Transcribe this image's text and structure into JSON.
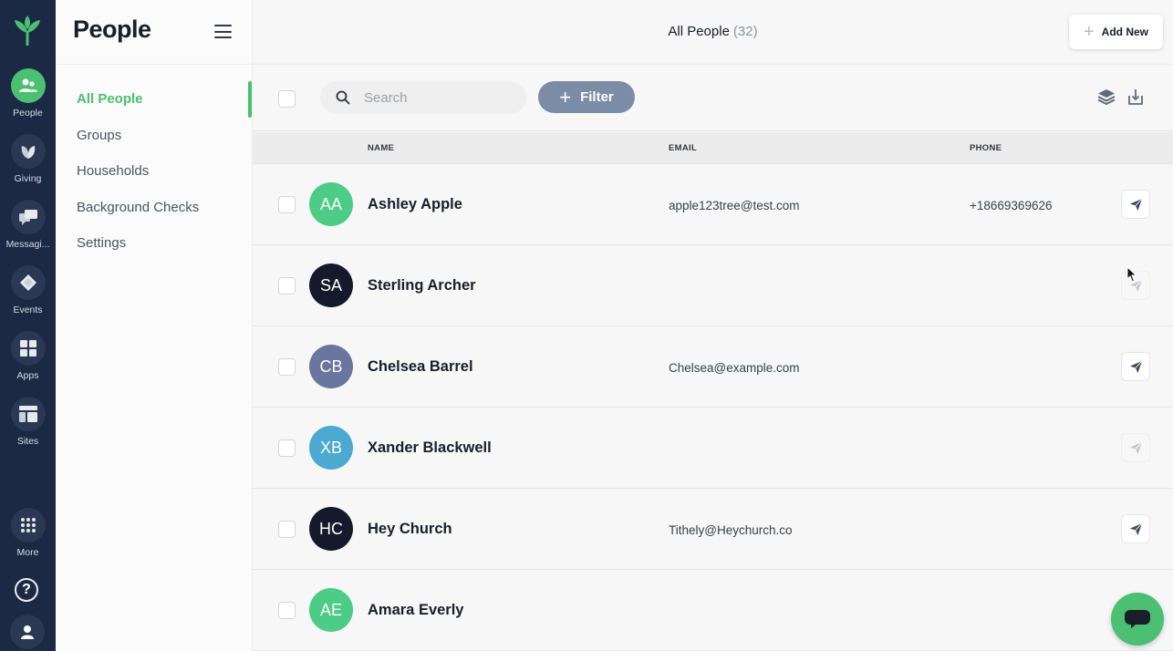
{
  "app": {
    "colors": {
      "rail_bg": "#1b2944",
      "accent": "#4bbf72",
      "filter_bg": "#7b8da6"
    }
  },
  "rail": {
    "items": [
      {
        "label": "People",
        "icon": "people-icon",
        "active": true
      },
      {
        "label": "Giving",
        "icon": "leaf-icon",
        "active": false
      },
      {
        "label": "Messagi...",
        "icon": "message-icon",
        "active": false
      },
      {
        "label": "Events",
        "icon": "ticket-icon",
        "active": false
      },
      {
        "label": "Apps",
        "icon": "apps-grid-icon",
        "active": false
      },
      {
        "label": "Sites",
        "icon": "layout-icon",
        "active": false
      },
      {
        "label": "More",
        "icon": "dots-grid-icon",
        "active": false
      }
    ],
    "help_glyph": "?"
  },
  "subnav": {
    "title": "People",
    "items": [
      "All People",
      "Groups",
      "Households",
      "Background Checks",
      "Settings"
    ],
    "active_index": 0
  },
  "topbar": {
    "title": "All People",
    "count": "(32)",
    "add_new_label": "Add New"
  },
  "toolbar": {
    "search_placeholder": "Search",
    "filter_label": "Filter"
  },
  "table": {
    "columns": [
      "NAME",
      "EMAIL",
      "PHONE"
    ],
    "rows": [
      {
        "initials": "AA",
        "name": "Ashley Apple",
        "email": "apple123tree@test.com",
        "phone": "+18669369626",
        "avatar_color": "#4ccc87",
        "send_enabled": true
      },
      {
        "initials": "SA",
        "name": "Sterling Archer",
        "email": "",
        "phone": "",
        "avatar_color": "#141a2b",
        "send_enabled": false
      },
      {
        "initials": "CB",
        "name": "Chelsea Barrel",
        "email": "Chelsea@example.com",
        "phone": "",
        "avatar_color": "#6a75a0",
        "send_enabled": true
      },
      {
        "initials": "XB",
        "name": "Xander Blackwell",
        "email": "",
        "phone": "",
        "avatar_color": "#4ca9d1",
        "send_enabled": false
      },
      {
        "initials": "HC",
        "name": "Hey Church",
        "email": "Tithely@Heychurch.co",
        "phone": "",
        "avatar_color": "#141a2b",
        "send_enabled": true
      },
      {
        "initials": "AE",
        "name": "Amara Everly",
        "email": "",
        "phone": "",
        "avatar_color": "#4ccc87",
        "send_enabled": false
      }
    ]
  }
}
